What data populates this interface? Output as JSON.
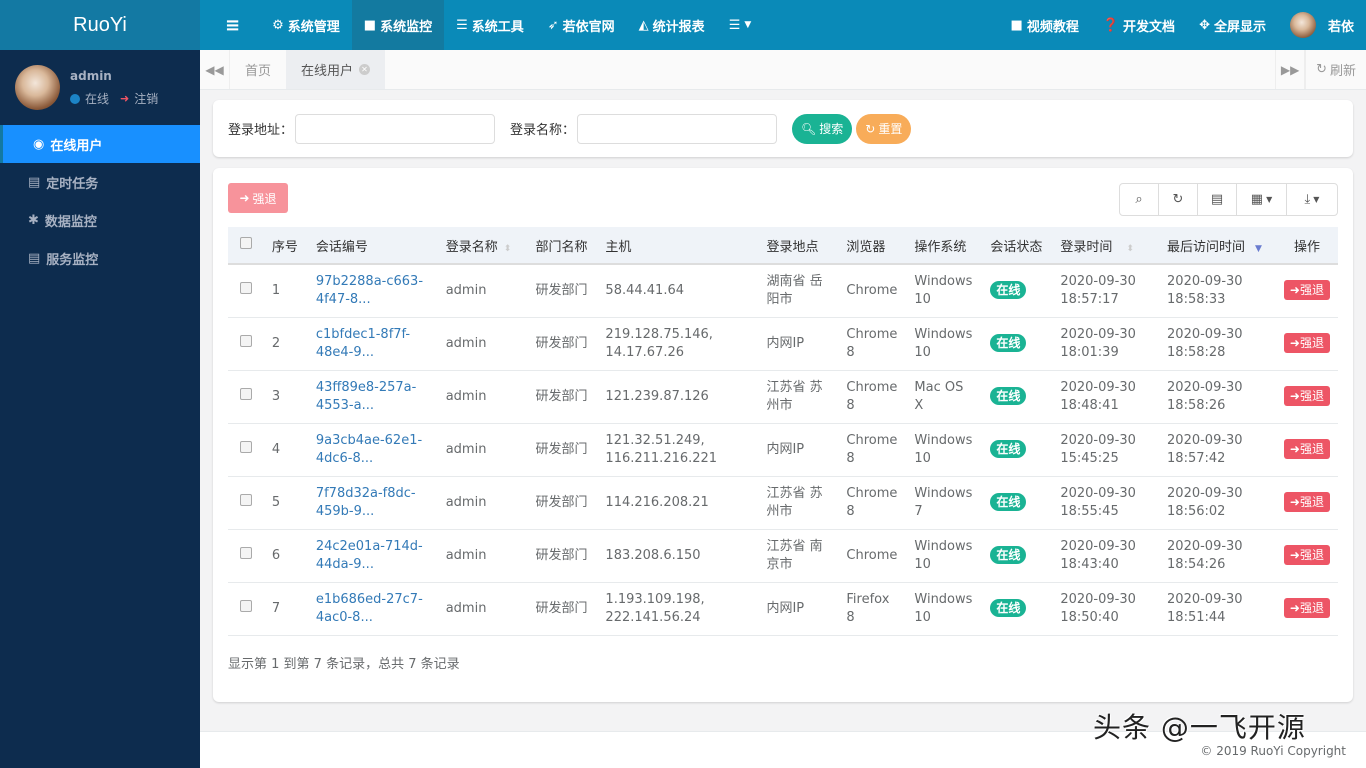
{
  "app": {
    "logo": "RuoYi"
  },
  "user_panel": {
    "name": "admin",
    "status": "在线",
    "logout": "注销"
  },
  "sidebar": {
    "items": [
      {
        "label": "在线用户",
        "icon": "user-circle-icon",
        "active": true
      },
      {
        "label": "定时任务",
        "icon": "tasks-icon"
      },
      {
        "label": "数据监控",
        "icon": "bug-icon"
      },
      {
        "label": "服务监控",
        "icon": "server-icon"
      }
    ]
  },
  "topnav": {
    "items": [
      {
        "label": "系统管理",
        "icon": "gear-icon"
      },
      {
        "label": "系统监控",
        "icon": "video-icon",
        "active": true
      },
      {
        "label": "系统工具",
        "icon": "bars-icon"
      },
      {
        "label": "若依官网",
        "icon": "location-arrow-icon"
      },
      {
        "label": "统计报表",
        "icon": "area-chart-icon"
      }
    ],
    "right": [
      {
        "label": "视频教程",
        "icon": "video-icon"
      },
      {
        "label": "开发文档",
        "icon": "question-icon"
      },
      {
        "label": "全屏显示",
        "icon": "fullscreen-icon"
      }
    ],
    "user": "若依"
  },
  "tabs": {
    "items": [
      {
        "label": "首页"
      },
      {
        "label": "在线用户",
        "active": true
      }
    ],
    "refresh": "刷新"
  },
  "search": {
    "ipaddr_label": "登录地址：",
    "ipaddr_value": "",
    "login_name_label": "登录名称：",
    "login_name_value": "",
    "search_btn": "搜索",
    "reset_btn": "重置"
  },
  "toolbar": {
    "force_logout": "强退"
  },
  "table": {
    "headers": [
      "",
      "序号",
      "会话编号",
      "登录名称",
      "部门名称",
      "主机",
      "登录地点",
      "浏览器",
      "操作系统",
      "会话状态",
      "登录时间",
      "最后访问时间",
      "操作"
    ],
    "rows": [
      {
        "index": "1",
        "session": "97b2288a-c663-4f47-8...",
        "login": "admin",
        "dept": "研发部门",
        "host": "58.44.41.64",
        "location": "湖南省 岳阳市",
        "browser": "Chrome",
        "os": "Windows 10",
        "status": "在线",
        "login_time": "2020-09-30 18:57:17",
        "last_access": "2020-09-30 18:58:33",
        "action": "强退"
      },
      {
        "index": "2",
        "session": "c1bfdec1-8f7f-48e4-9...",
        "login": "admin",
        "dept": "研发部门",
        "host": "219.128.75.146, 14.17.67.26",
        "location": "内网IP",
        "browser": "Chrome 8",
        "os": "Windows 10",
        "status": "在线",
        "login_time": "2020-09-30 18:01:39",
        "last_access": "2020-09-30 18:58:28",
        "action": "强退"
      },
      {
        "index": "3",
        "session": "43ff89e8-257a-4553-a...",
        "login": "admin",
        "dept": "研发部门",
        "host": "121.239.87.126",
        "location": "江苏省 苏州市",
        "browser": "Chrome 8",
        "os": "Mac OS X",
        "status": "在线",
        "login_time": "2020-09-30 18:48:41",
        "last_access": "2020-09-30 18:58:26",
        "action": "强退"
      },
      {
        "index": "4",
        "session": "9a3cb4ae-62e1-4dc6-8...",
        "login": "admin",
        "dept": "研发部门",
        "host": "121.32.51.249, 116.211.216.221",
        "location": "内网IP",
        "browser": "Chrome 8",
        "os": "Windows 10",
        "status": "在线",
        "login_time": "2020-09-30 15:45:25",
        "last_access": "2020-09-30 18:57:42",
        "action": "强退"
      },
      {
        "index": "5",
        "session": "7f78d32a-f8dc-459b-9...",
        "login": "admin",
        "dept": "研发部门",
        "host": "114.216.208.21",
        "location": "江苏省 苏州市",
        "browser": "Chrome 8",
        "os": "Windows 7",
        "status": "在线",
        "login_time": "2020-09-30 18:55:45",
        "last_access": "2020-09-30 18:56:02",
        "action": "强退"
      },
      {
        "index": "6",
        "session": "24c2e01a-714d-44da-9...",
        "login": "admin",
        "dept": "研发部门",
        "host": "183.208.6.150",
        "location": "江苏省 南京市",
        "browser": "Chrome",
        "os": "Windows 10",
        "status": "在线",
        "login_time": "2020-09-30 18:43:40",
        "last_access": "2020-09-30 18:54:26",
        "action": "强退"
      },
      {
        "index": "7",
        "session": "e1b686ed-27c7-4ac0-8...",
        "login": "admin",
        "dept": "研发部门",
        "host": "1.193.109.198, 222.141.56.24",
        "location": "内网IP",
        "browser": "Firefox 8",
        "os": "Windows 10",
        "status": "在线",
        "login_time": "2020-09-30 18:50:40",
        "last_access": "2020-09-30 18:51:44",
        "action": "强退"
      }
    ]
  },
  "pagination": {
    "info": "显示第 1 到第 7 条记录，总共 7 条记录"
  },
  "footer": {
    "copyright": "© 2019 RuoYi Copyright"
  },
  "watermark": "头条 @一飞开源",
  "colors": {
    "topbar": "#0a8ab8",
    "sidebar": "#0d2c4e",
    "active_menu": "#1890ff",
    "success": "#1ab394",
    "danger": "#ed5565",
    "warning": "#f8ac59"
  }
}
